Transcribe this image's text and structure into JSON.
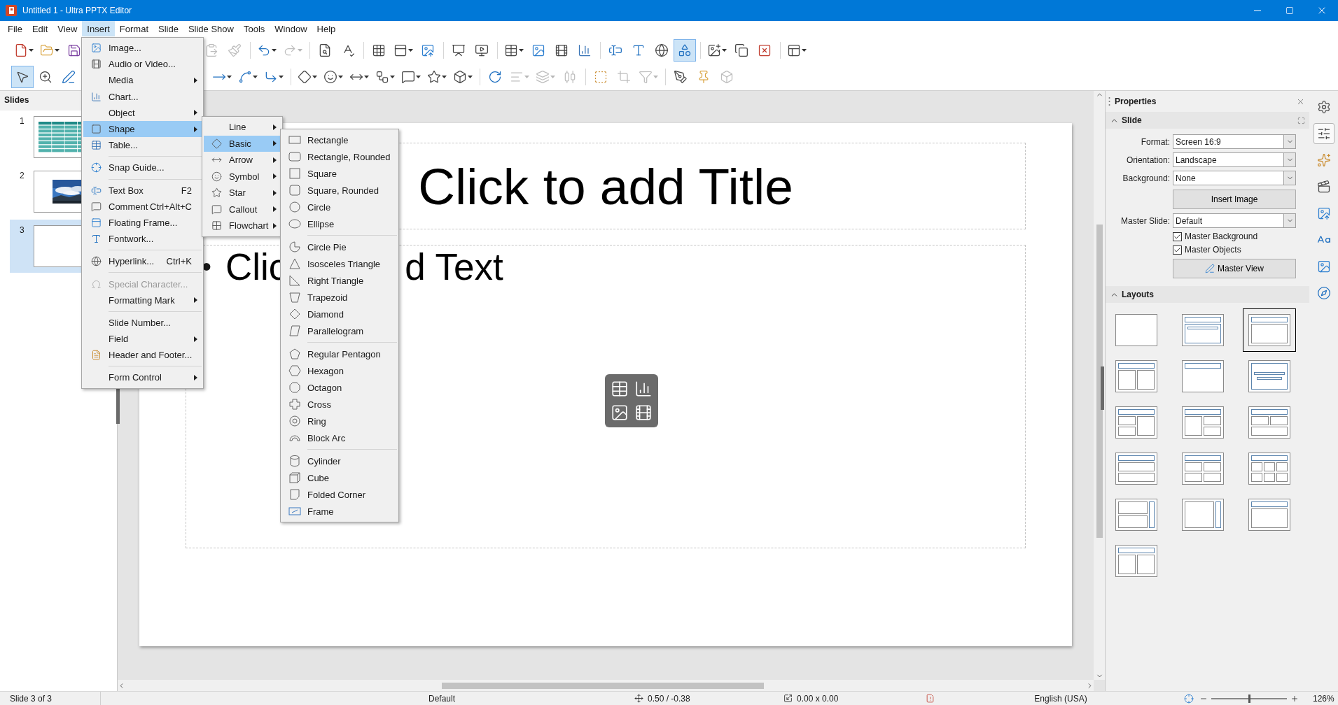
{
  "window": {
    "title": "Untitled 1 - Ultra PPTX Editor"
  },
  "menu_bar": [
    {
      "label": "File",
      "selected": false
    },
    {
      "label": "Edit",
      "selected": false
    },
    {
      "label": "View",
      "selected": false
    },
    {
      "label": "Insert",
      "selected": true
    },
    {
      "label": "Format",
      "selected": false
    },
    {
      "label": "Slide",
      "selected": false
    },
    {
      "label": "Slide Show",
      "selected": false
    },
    {
      "label": "Tools",
      "selected": false
    },
    {
      "label": "Window",
      "selected": false
    },
    {
      "label": "Help",
      "selected": false
    }
  ],
  "insert_menu": {
    "items": [
      {
        "kind": "item",
        "label": "Image...",
        "has_submenu": false,
        "disabled": false,
        "selected": false
      },
      {
        "kind": "item",
        "label": "Audio or Video...",
        "has_submenu": false,
        "disabled": false,
        "selected": false
      },
      {
        "kind": "item",
        "label": "Media",
        "has_submenu": true,
        "disabled": false,
        "selected": false
      },
      {
        "kind": "item",
        "label": "Chart...",
        "has_submenu": false,
        "disabled": false,
        "selected": false
      },
      {
        "kind": "item",
        "label": "Object",
        "has_submenu": true,
        "disabled": false,
        "selected": false
      },
      {
        "kind": "item",
        "label": "Shape",
        "has_submenu": true,
        "disabled": false,
        "selected": true
      },
      {
        "kind": "item",
        "label": "Table...",
        "has_submenu": false,
        "disabled": false,
        "selected": false
      },
      {
        "kind": "separator"
      },
      {
        "kind": "item",
        "label": "Snap Guide...",
        "has_submenu": false,
        "disabled": false,
        "selected": false
      },
      {
        "kind": "separator"
      },
      {
        "kind": "item",
        "label": "Text Box",
        "shortcut": "F2",
        "has_submenu": false,
        "disabled": false,
        "selected": false
      },
      {
        "kind": "item",
        "label": "Comment",
        "shortcut": "Ctrl+Alt+C",
        "has_submenu": false,
        "disabled": false,
        "selected": false
      },
      {
        "kind": "item",
        "label": "Floating Frame...",
        "has_submenu": false,
        "disabled": false,
        "selected": false
      },
      {
        "kind": "item",
        "label": "Fontwork...",
        "has_submenu": false,
        "disabled": false,
        "selected": false
      },
      {
        "kind": "separator"
      },
      {
        "kind": "item",
        "label": "Hyperlink...",
        "shortcut": "Ctrl+K",
        "has_submenu": false,
        "disabled": false,
        "selected": false
      },
      {
        "kind": "separator"
      },
      {
        "kind": "item",
        "label": "Special Character...",
        "has_submenu": false,
        "disabled": true,
        "selected": false
      },
      {
        "kind": "item",
        "label": "Formatting Mark",
        "has_submenu": true,
        "disabled": false,
        "selected": false
      },
      {
        "kind": "separator"
      },
      {
        "kind": "item",
        "label": "Slide Number...",
        "has_submenu": false,
        "disabled": false,
        "selected": false
      },
      {
        "kind": "item",
        "label": "Field",
        "has_submenu": true,
        "disabled": false,
        "selected": false
      },
      {
        "kind": "item",
        "label": "Header and Footer...",
        "has_submenu": false,
        "disabled": false,
        "selected": false
      },
      {
        "kind": "separator"
      },
      {
        "kind": "item",
        "label": "Form Control",
        "has_submenu": true,
        "disabled": false,
        "selected": false
      }
    ]
  },
  "shape_menu": {
    "items": [
      {
        "kind": "item",
        "label": "Line",
        "has_submenu": true,
        "selected": false
      },
      {
        "kind": "item",
        "label": "Basic",
        "has_submenu": true,
        "selected": true
      },
      {
        "kind": "item",
        "label": "Arrow",
        "has_submenu": true,
        "selected": false
      },
      {
        "kind": "item",
        "label": "Symbol",
        "has_submenu": true,
        "selected": false
      },
      {
        "kind": "item",
        "label": "Star",
        "has_submenu": true,
        "selected": false
      },
      {
        "kind": "item",
        "label": "Callout",
        "has_submenu": true,
        "selected": false
      },
      {
        "kind": "item",
        "label": "Flowchart",
        "has_submenu": true,
        "selected": false
      }
    ]
  },
  "basic_menu": {
    "items": [
      {
        "kind": "item",
        "label": "Rectangle",
        "selected": false
      },
      {
        "kind": "item",
        "label": "Rectangle, Rounded",
        "selected": false
      },
      {
        "kind": "item",
        "label": "Square",
        "selected": false
      },
      {
        "kind": "item",
        "label": "Square, Rounded",
        "selected": false
      },
      {
        "kind": "item",
        "label": "Circle",
        "selected": false
      },
      {
        "kind": "item",
        "label": "Ellipse",
        "selected": false
      },
      {
        "kind": "separator"
      },
      {
        "kind": "item",
        "label": "Circle Pie",
        "selected": false
      },
      {
        "kind": "item",
        "label": "Isosceles Triangle",
        "selected": false
      },
      {
        "kind": "item",
        "label": "Right Triangle",
        "selected": false
      },
      {
        "kind": "item",
        "label": "Trapezoid",
        "selected": false
      },
      {
        "kind": "item",
        "label": "Diamond",
        "selected": false
      },
      {
        "kind": "item",
        "label": "Parallelogram",
        "selected": false
      },
      {
        "kind": "separator"
      },
      {
        "kind": "item",
        "label": "Regular Pentagon",
        "selected": false
      },
      {
        "kind": "item",
        "label": "Hexagon",
        "selected": false
      },
      {
        "kind": "item",
        "label": "Octagon",
        "selected": false
      },
      {
        "kind": "item",
        "label": "Cross",
        "selected": false
      },
      {
        "kind": "item",
        "label": "Ring",
        "selected": false
      },
      {
        "kind": "item",
        "label": "Block Arc",
        "selected": false
      },
      {
        "kind": "separator"
      },
      {
        "kind": "item",
        "label": "Cylinder",
        "selected": false
      },
      {
        "kind": "item",
        "label": "Cube",
        "selected": false
      },
      {
        "kind": "item",
        "label": "Folded Corner",
        "selected": false
      },
      {
        "kind": "item",
        "label": "Frame",
        "selected": false
      }
    ]
  },
  "slides_panel": {
    "title": "Slides",
    "slides": [
      {
        "number": "1",
        "kind": "table",
        "selected": false
      },
      {
        "number": "2",
        "kind": "picture",
        "selected": false
      },
      {
        "number": "3",
        "kind": "blank",
        "selected": true
      }
    ]
  },
  "slide": {
    "title_placeholder": "Click to add Title",
    "bullet": "•",
    "text_placeholder_visible": [
      "Clic",
      "d Text"
    ]
  },
  "properties": {
    "title": "Properties",
    "slide_section": {
      "title": "Slide",
      "expanded": true,
      "fields": [
        {
          "label": "Format:",
          "value": "Screen 16:9"
        },
        {
          "label": "Orientation:",
          "value": "Landscape"
        },
        {
          "label": "Background:",
          "value": "None"
        }
      ],
      "insert_image": "Insert Image",
      "master_slide": {
        "label": "Master Slide:",
        "value": "Default"
      },
      "checkboxes": [
        {
          "label": "Master Background",
          "checked": true
        },
        {
          "label": "Master Objects",
          "checked": true
        }
      ],
      "master_view": "Master View"
    },
    "layouts_section": {
      "title": "Layouts",
      "expanded": true,
      "layouts": [
        {
          "kind": "blank",
          "selected": false
        },
        {
          "kind": "subtitle",
          "selected": false
        },
        {
          "kind": "content",
          "selected": true
        },
        {
          "kind": "two",
          "selected": false
        },
        {
          "kind": "titleonly",
          "selected": false
        },
        {
          "kind": "centered",
          "selected": false
        },
        {
          "kind": "twoleft",
          "selected": false
        },
        {
          "kind": "tworight",
          "selected": false
        },
        {
          "kind": "twotop",
          "selected": false
        },
        {
          "kind": "stacked",
          "selected": false
        },
        {
          "kind": "four",
          "selected": false
        },
        {
          "kind": "six",
          "selected": false
        },
        {
          "kind": "vertical",
          "selected": false
        },
        {
          "kind": "verticaltext",
          "selected": false
        },
        {
          "kind": "content",
          "selected": false
        },
        {
          "kind": "two",
          "selected": false
        }
      ]
    }
  },
  "status_bar": {
    "slide_info": "Slide 3 of 3",
    "master": "Default",
    "position": "0.50 / -0.38",
    "size": "0.00 x 0.00",
    "language": "English (USA)",
    "zoom_slider": {
      "level": 0.5
    },
    "zoom": "126%"
  }
}
